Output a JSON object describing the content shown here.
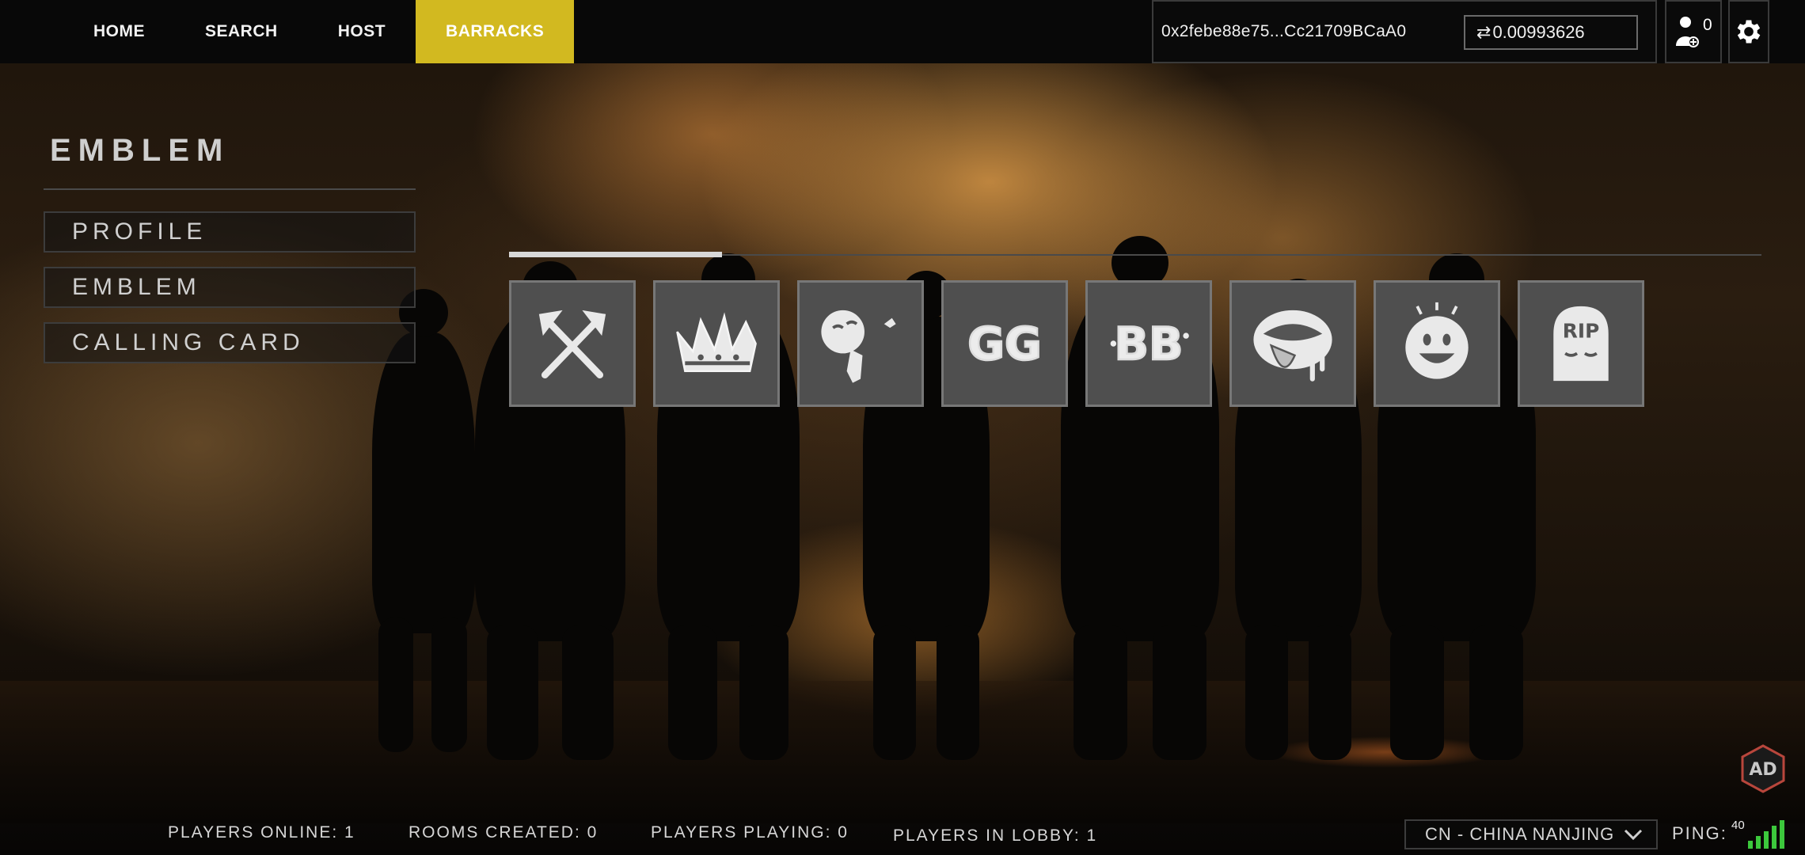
{
  "nav": {
    "tabs": [
      {
        "label": "HOME",
        "active": false
      },
      {
        "label": "SEARCH",
        "active": false
      },
      {
        "label": "HOST",
        "active": false
      },
      {
        "label": "BARRACKS",
        "active": true
      }
    ],
    "active_color": "#d2b920"
  },
  "wallet": {
    "address": "0x2febe88e75...Cc21709BCaA0",
    "balance": "0.00993626",
    "balance_icon": "swap-arrows-icon"
  },
  "friends": {
    "count": "0",
    "icon": "user-add-icon"
  },
  "settings": {
    "icon": "gear-icon"
  },
  "sidebar": {
    "title": "EMBLEM",
    "items": [
      {
        "label": "PROFILE"
      },
      {
        "label": "EMBLEM"
      },
      {
        "label": "CALLING CARD"
      }
    ]
  },
  "emblems": {
    "items": [
      {
        "icon": "crossed-axes-icon"
      },
      {
        "icon": "crown-icon"
      },
      {
        "icon": "smoker-face-icon"
      },
      {
        "icon": "gg-text-icon"
      },
      {
        "icon": "bb-text-icon"
      },
      {
        "icon": "mouth-tongue-icon"
      },
      {
        "icon": "smiley-face-icon"
      },
      {
        "icon": "rip-tombstone-icon"
      }
    ],
    "page_progress": 0.17
  },
  "footer": {
    "players_online": "PLAYERS ONLINE: 1",
    "rooms_created": "ROOMS CREATED: 0",
    "players_playing": "PLAYERS PLAYING: 0",
    "players_in_lobby": "PLAYERS IN LOBBY: 1",
    "region": "CN - CHINA NANJING",
    "ping_label": "PING:",
    "ping_value": "40",
    "signal_color": "#3cc83c"
  }
}
